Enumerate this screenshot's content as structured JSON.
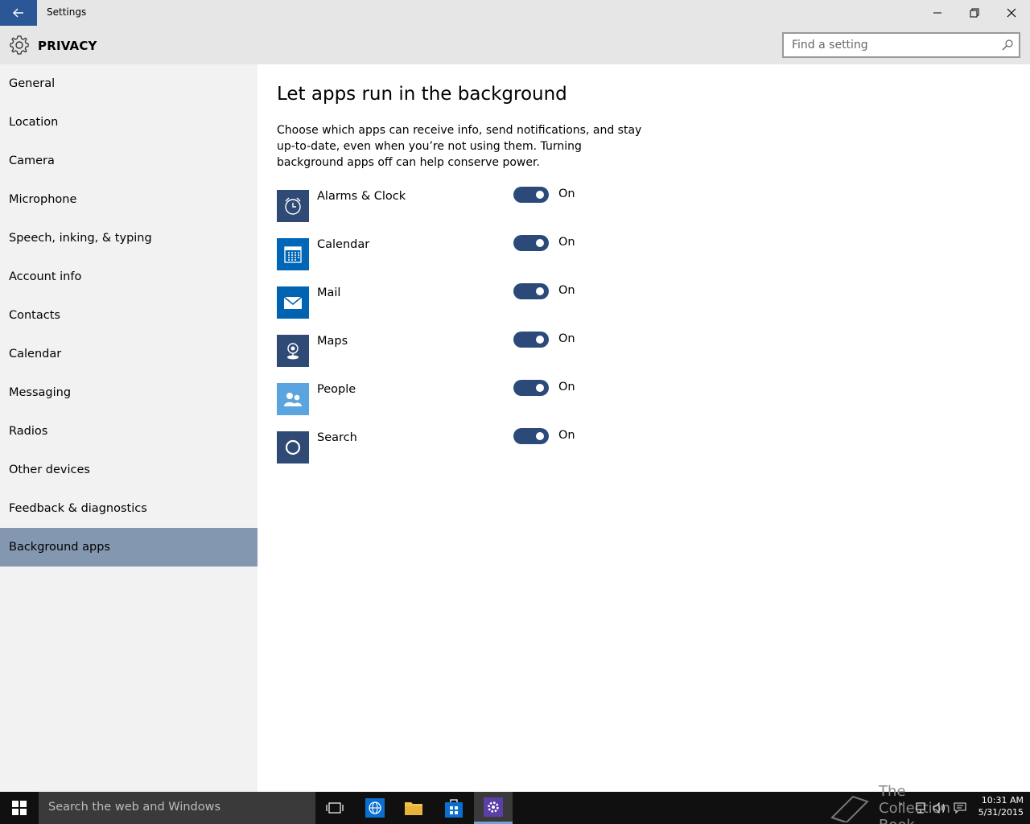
{
  "window": {
    "title": "Settings"
  },
  "header": {
    "title": "PRIVACY",
    "search_placeholder": "Find a setting"
  },
  "sidebar": {
    "items": [
      {
        "label": "General"
      },
      {
        "label": "Location"
      },
      {
        "label": "Camera"
      },
      {
        "label": "Microphone"
      },
      {
        "label": "Speech, inking, & typing"
      },
      {
        "label": "Account info"
      },
      {
        "label": "Contacts"
      },
      {
        "label": "Calendar"
      },
      {
        "label": "Messaging"
      },
      {
        "label": "Radios"
      },
      {
        "label": "Other devices"
      },
      {
        "label": "Feedback & diagnostics"
      },
      {
        "label": "Background apps",
        "selected": true
      }
    ]
  },
  "main": {
    "title": "Let apps run in the background",
    "description": "Choose which apps can receive info, send notifications, and stay up-to-date, even when you’re not using them. Turning background apps off can help conserve power.",
    "apps": [
      {
        "name": "Alarms & Clock",
        "icon": "alarm-clock-icon",
        "tile_color": "#2f4a75",
        "state": "On"
      },
      {
        "name": "Calendar",
        "icon": "calendar-icon",
        "tile_color": "#0067b8",
        "state": "On"
      },
      {
        "name": "Mail",
        "icon": "mail-icon",
        "tile_color": "#0063b1",
        "state": "On"
      },
      {
        "name": "Maps",
        "icon": "maps-icon",
        "tile_color": "#2f4a75",
        "state": "On"
      },
      {
        "name": "People",
        "icon": "people-icon",
        "tile_color": "#5aa5e0",
        "state": "On"
      },
      {
        "name": "Search",
        "icon": "cortana-icon",
        "tile_color": "#2f4a75",
        "state": "On"
      }
    ]
  },
  "taskbar": {
    "search_placeholder": "Search the web and Windows",
    "watermark": "The Collection Book",
    "time": "10:31 AM",
    "date": "5/31/2015"
  },
  "colors": {
    "accent": "#2b5797",
    "toggle_on": "#2b4a7a",
    "sidebar_selected": "#8497b0",
    "chrome": "#e6e6e6"
  }
}
